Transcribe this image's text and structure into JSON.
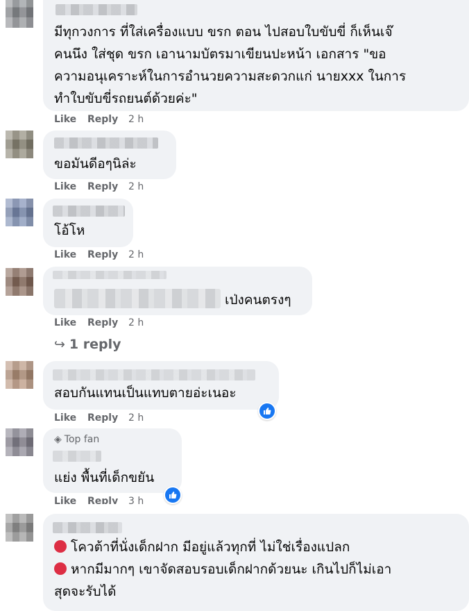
{
  "comments": [
    {
      "text": "มีทุกวงการ ที่ใส่เครื่องแบบ ขรก ตอน ไปสอบใบขับขี่ ก็เห็นเจ๊\nคนนึง ใส่ชุด ขรก เอานามบัตรมาเขียนปะหน้า เอกสาร \"ขอ\nความอนุเคราะห์ในการอำนวยความสะดวกแก่ นายxxx ในการ\nทำใบขับขี่รถยนต์ด้วยค่ะ\"",
      "like": "Like",
      "reply": "Reply",
      "time": "2 h"
    },
    {
      "text": "ขอมันดีอๆนิล่ะ",
      "like": "Like",
      "reply": "Reply",
      "time": "2 h"
    },
    {
      "text": "โอ้โห",
      "like": "Like",
      "reply": "Reply",
      "time": "2 h"
    },
    {
      "text": "เป่งคนตรงๆ",
      "like": "Like",
      "reply": "Reply",
      "time": "2 h",
      "replies_link": "1 reply",
      "replies_icon": "reply-arrow-icon"
    },
    {
      "text": "สอบกันแทนเป็นแทบตายอ่ะเนอะ",
      "like": "Like",
      "reply": "Reply",
      "time": "2 h",
      "reaction_icon": "like-reaction-icon"
    },
    {
      "badge": "Top fan",
      "badge_icon": "diamond-icon",
      "text": "แย่ง พื้นที่เด็กขยัน",
      "like": "Like",
      "reply": "Reply",
      "time": "3 h",
      "reaction_icon": "like-reaction-icon"
    },
    {
      "line1": "โควต้าที่นั่งเด็กฝาก มีอยู่แล้วทุกที่ ไม่ใช่เรื่องแปลก",
      "line2": "หากมีมากๆ เขาจัดสอบรอบเด็กฝากด้วยนะ เกินไปก็ไม่เอา",
      "line3": "สุดจะรับได้",
      "bullet_icon": "red-circle-icon"
    }
  ],
  "colors": {
    "bubble": "#f0f2f5",
    "meta": "#65676b",
    "like_blue": "#1877f2",
    "red_circle": "#dd2e44"
  }
}
